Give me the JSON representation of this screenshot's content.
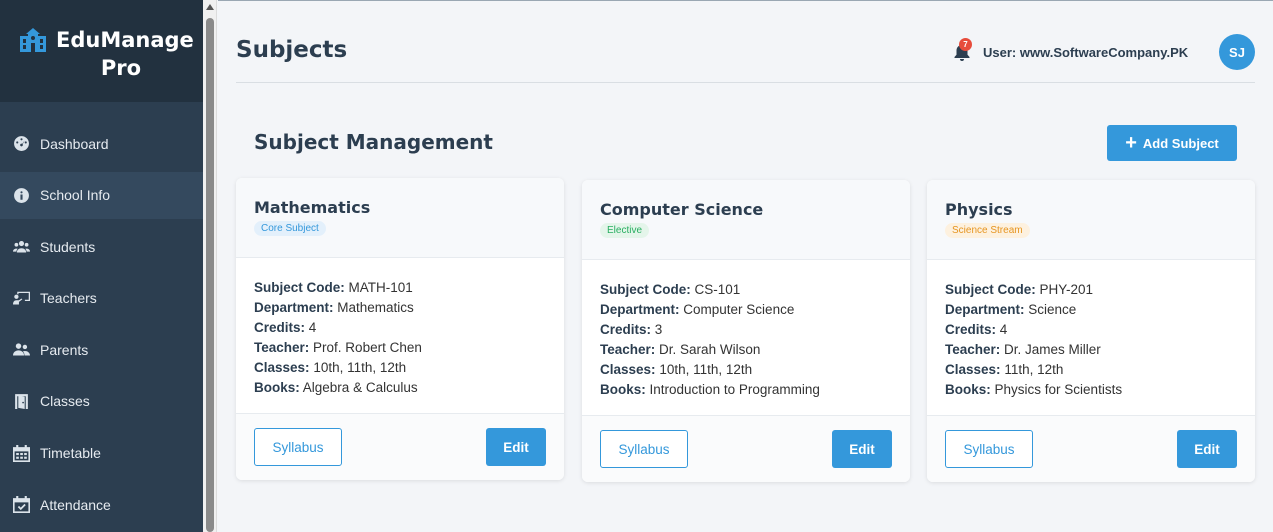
{
  "brand": {
    "line1": "EduManage",
    "line2": "Pro"
  },
  "sidebar": {
    "items": [
      {
        "label": "Dashboard",
        "icon": "dashboard-icon"
      },
      {
        "label": "School Info",
        "icon": "info-icon"
      },
      {
        "label": "Students",
        "icon": "users-icon"
      },
      {
        "label": "Teachers",
        "icon": "teacher-icon"
      },
      {
        "label": "Parents",
        "icon": "parents-icon"
      },
      {
        "label": "Classes",
        "icon": "door-icon"
      },
      {
        "label": "Timetable",
        "icon": "calendar-icon"
      },
      {
        "label": "Attendance",
        "icon": "calendar-check-icon"
      }
    ]
  },
  "header": {
    "title": "Subjects",
    "notification_count": "7",
    "user_label": "User: www.SoftwareCompany.PK",
    "avatar_initials": "SJ"
  },
  "section": {
    "title": "Subject Management",
    "add_label": "Add Subject"
  },
  "colors": {
    "accent": "#3498db",
    "sidebar": "#2c3e50",
    "badge_red": "#e74c3c"
  },
  "subjects": [
    {
      "name": "Mathematics",
      "badge": "Core Subject",
      "badge_bg": "#e3f0fb",
      "badge_color": "#3498db",
      "code_label": "Subject Code:",
      "code": "MATH-101",
      "dept_label": "Department:",
      "department": "Mathematics",
      "credits_label": "Credits:",
      "credits": "4",
      "teacher_label": "Teacher:",
      "teacher": "Prof. Robert Chen",
      "classes_label": "Classes:",
      "classes": "10th, 11th, 12th",
      "books_label": "Books:",
      "books": "Algebra & Calculus",
      "syllabus_label": "Syllabus",
      "edit_label": "Edit"
    },
    {
      "name": "Computer Science",
      "badge": "Elective",
      "badge_bg": "#e4f5ea",
      "badge_color": "#27ae60",
      "code_label": "Subject Code:",
      "code": "CS-101",
      "dept_label": "Department:",
      "department": "Computer Science",
      "credits_label": "Credits:",
      "credits": "3",
      "teacher_label": "Teacher:",
      "teacher": "Dr. Sarah Wilson",
      "classes_label": "Classes:",
      "classes": "10th, 11th, 12th",
      "books_label": "Books:",
      "books": "Introduction to Programming",
      "syllabus_label": "Syllabus",
      "edit_label": "Edit"
    },
    {
      "name": "Physics",
      "badge": "Science Stream",
      "badge_bg": "#fdf1df",
      "badge_color": "#e69520",
      "code_label": "Subject Code:",
      "code": "PHY-201",
      "dept_label": "Department:",
      "department": "Science",
      "credits_label": "Credits:",
      "credits": "4",
      "teacher_label": "Teacher:",
      "teacher": "Dr. James Miller",
      "classes_label": "Classes:",
      "classes": "11th, 12th",
      "books_label": "Books:",
      "books": "Physics for Scientists",
      "syllabus_label": "Syllabus",
      "edit_label": "Edit"
    }
  ]
}
